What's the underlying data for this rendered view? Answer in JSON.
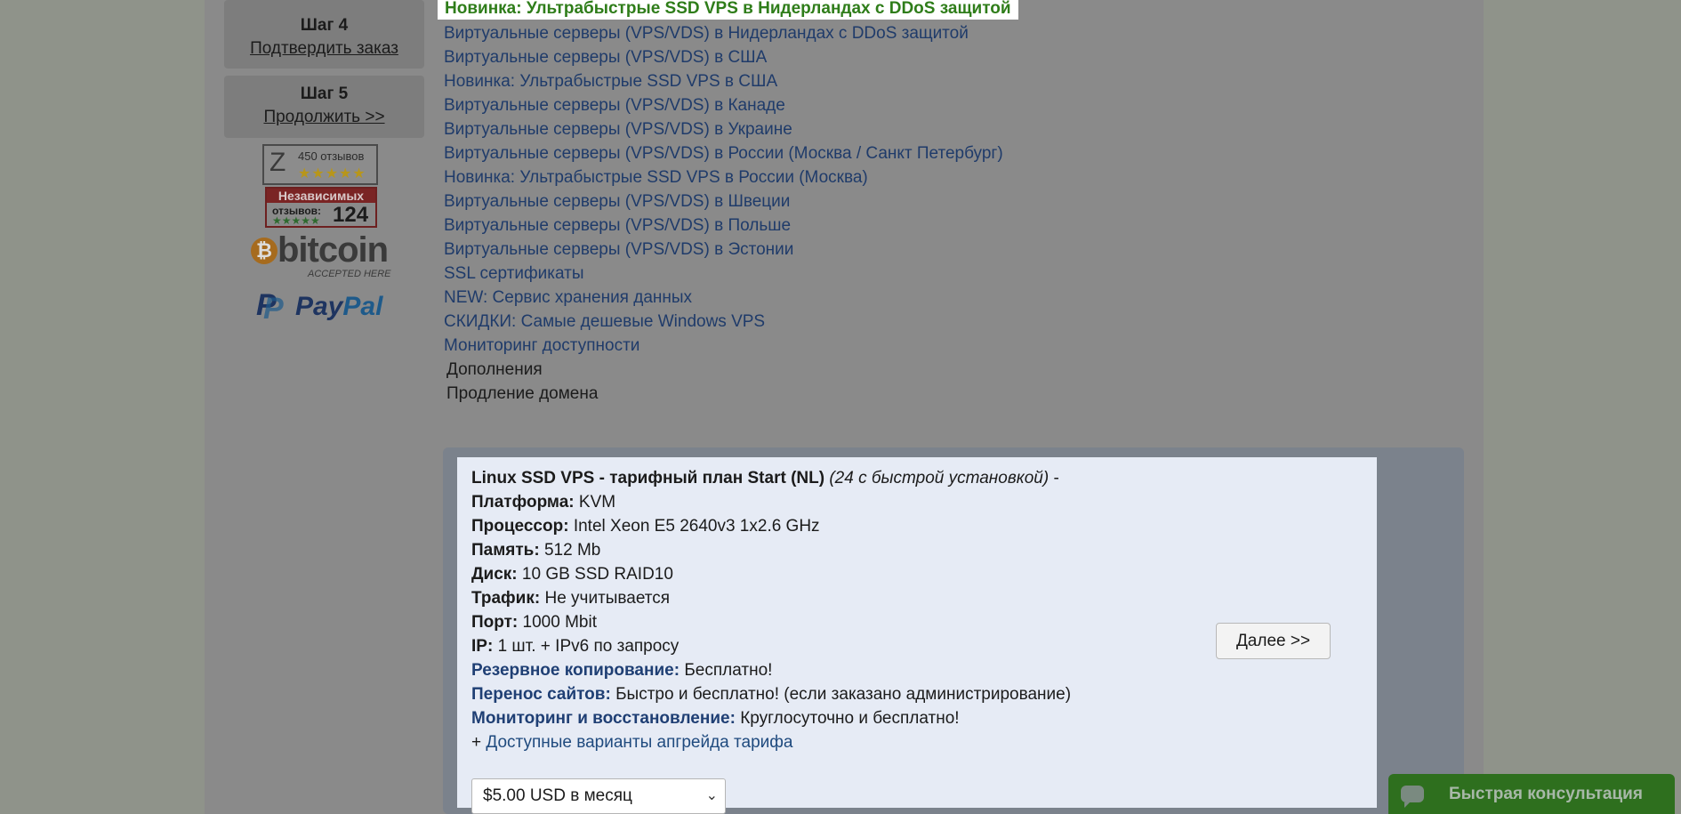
{
  "sidebar": {
    "step4": {
      "title": "Шаг 4",
      "link": "Подтвердить заказ"
    },
    "step5": {
      "title": "Шаг 5",
      "link": "Продолжить >>"
    },
    "zoon_badge": {
      "letter": "Z",
      "count": "450 отзывов",
      "stars": "★★★★★"
    },
    "independent_badge": {
      "top": "Независимых",
      "label": "отзывов:",
      "count": "124",
      "stars": "★★★★★"
    },
    "bitcoin": {
      "word": "bitcoin",
      "tag": "ACCEPTED HERE",
      "symbol": "₿"
    },
    "paypal": {
      "word_a": "Pay",
      "word_b": "Pal",
      "mark": "P"
    }
  },
  "nav": {
    "active": "Новинка: Ультрабыстрые SSD VPS в Нидерландах с DDoS защитой",
    "items": [
      "Виртуальные серверы (VPS/VDS) в Нидерландах с DDoS защитой",
      "Виртуальные серверы (VPS/VDS) в США",
      "Новинка: Ультрабыстрые SSD VPS в США",
      "Виртуальные серверы (VPS/VDS) в Канаде",
      "Виртуальные серверы (VPS/VDS) в Украине",
      "Виртуальные серверы (VPS/VDS) в России (Москва / Санкт Петербург)",
      "Новинка: Ультрабыстрые SSD VPS в России (Москва)",
      "Виртуальные серверы (VPS/VDS) в Швеции",
      "Виртуальные серверы (VPS/VDS) в Польше",
      "Виртуальные серверы (VPS/VDS) в Эстонии",
      "SSL сертификаты",
      "NEW: Сервис хранения данных",
      "СКИДКИ: Самые дешевые Windows VPS",
      "Мониторинг доступности"
    ],
    "plain_items": [
      "Дополнения",
      "Продление домена"
    ]
  },
  "product": {
    "title": "Linux SSD VPS - тарифный план Start (NL)",
    "subtitle": "(24 с быстрой установкой)",
    "dash": " -",
    "specs": [
      {
        "label": "Платформа:",
        "value": "KVM"
      },
      {
        "label": "Процессор:",
        "value": "Intel Xeon E5 2640v3 1x2.6 GHz"
      },
      {
        "label": "Память:",
        "value": "512 Mb"
      },
      {
        "label": "Диск:",
        "value": "10 GB SSD RAID10"
      },
      {
        "label": "Трафик:",
        "value": "Не учитывается"
      },
      {
        "label": "Порт:",
        "value": "1000 Mbit"
      },
      {
        "label": "IP:",
        "value": "1 шт. + IPv6 по запросу"
      }
    ],
    "features": [
      {
        "label": "Резервное копирование:",
        "value": "Бесплатно!"
      },
      {
        "label": "Перенос сайтов:",
        "value": "Быстро и бесплатно! (если заказано администрирование)"
      },
      {
        "label": "Мониторинг и восстановление:",
        "value": "Круглосуточно и бесплатно!"
      }
    ],
    "upgrade_prefix": "+ ",
    "upgrade_link": "Доступные варианты апгрейда тарифа",
    "next_button": "Далее >>",
    "price_select": "$5.00 USD в месяц"
  },
  "chat": {
    "label": "Быстрая консультация"
  },
  "icons": {
    "chevron": "chevron-down-icon",
    "chat": "chat-bubble-icon"
  }
}
